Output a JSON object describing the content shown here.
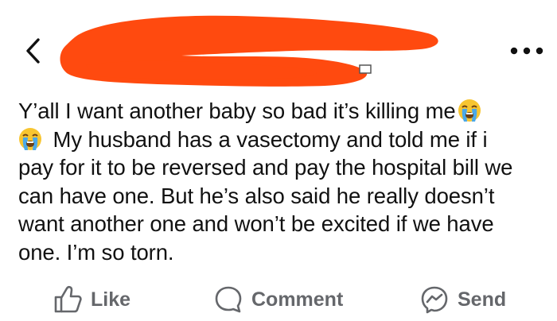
{
  "header": {
    "back_icon": "chevron-left-icon",
    "more_icon": "more-options-icon",
    "redaction_color": "#ff4a0f"
  },
  "post": {
    "text_part1": "Y’all I want another baby so bad it’s killing me",
    "text_part2": " My husband has a vasectomy and told me if i pay for it to be reversed and pay the hospital bill we can have one. But he’s also said he really doesn’t want another one and won’t be excited if we have one. I’m so torn.",
    "emoji_icon": "loudly-crying-face-icon"
  },
  "actions": {
    "like_label": "Like",
    "comment_label": "Comment",
    "send_label": "Send",
    "color": "#65676b"
  }
}
